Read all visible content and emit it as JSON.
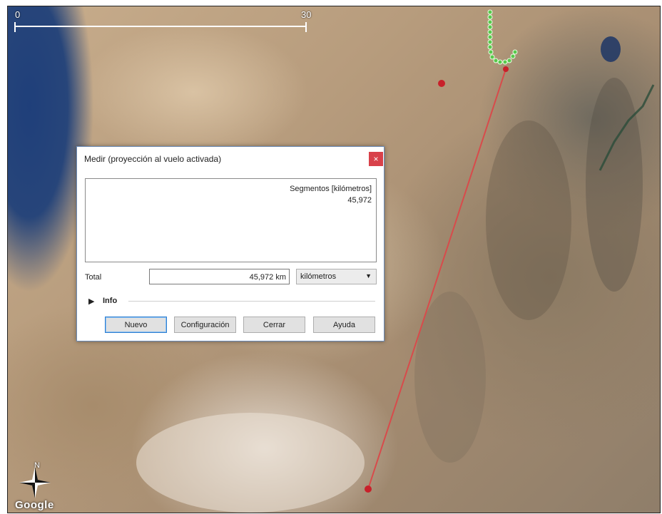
{
  "map": {
    "scale_start": "0",
    "scale_end": "30",
    "north_label": "N",
    "logo_text": "Google"
  },
  "dialog": {
    "title": "Medir (proyección al vuelo activada)",
    "close_glyph": "×",
    "segments_header": "Segmentos [kilómetros]",
    "segment_value": "45,972",
    "total_label": "Total",
    "total_value": "45,972 km",
    "unit_selected": "kilómetros",
    "info_label": "Info",
    "buttons": {
      "new": "Nuevo",
      "config": "Configuración",
      "close": "Cerrar",
      "help": "Ayuda"
    }
  },
  "colors": {
    "measure_line": "#d84b4b",
    "track_points": "#58c94c"
  }
}
